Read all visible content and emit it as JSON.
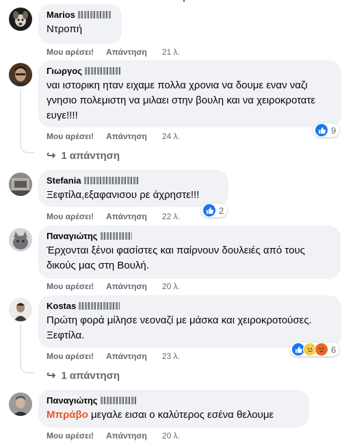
{
  "labels": {
    "like": "Μου αρέσει!",
    "reply": "Απάντηση"
  },
  "comments": [
    {
      "author": "Marios",
      "text": "Ντροπή",
      "time": "21 λ."
    },
    {
      "author": "Γιωργος",
      "text": "ναι ιστορικη ηταν ειχαμε πολλα χρονια να δουμε εναν ναζι γνησιο πολεμιστη να μιλαει στην βουλη και να χειροκροτατε ευγε!!!!",
      "time": "24 λ.",
      "reaction_count": "9",
      "replies_label": "1 απάντηση"
    },
    {
      "author": "Stefania",
      "text": "Ξεφτίλα,εξαφανισου ρε άχρηστε!!!",
      "time": "22 λ.",
      "reaction_count": "2"
    },
    {
      "author": "Παναγιώτης",
      "text": "Έρχονται ξένοι φασίστες και παίρνουν δουλειές από τους δικούς μας στη Βουλή.",
      "time": "20 λ."
    },
    {
      "author": "Kostas",
      "text": "Πρώτη φορά μίλησε νεοναζί με μάσκα και χειροκροτούσες. Ξεφτίλα.",
      "time": "23 λ.",
      "reaction_count": "6",
      "replies_label": "1 απάντηση"
    },
    {
      "author": "Παναγιώτης",
      "text_highlight": "Μπράβο",
      "text": " μεγαλε εισαι ο καλύτερος εσένα θελουμε",
      "time": "20 λ."
    }
  ],
  "colors": {
    "bubble": "#f0f2f5",
    "secondary_text": "#65676b",
    "like_blue": "#1877f2",
    "highlight": "#e4572e"
  }
}
